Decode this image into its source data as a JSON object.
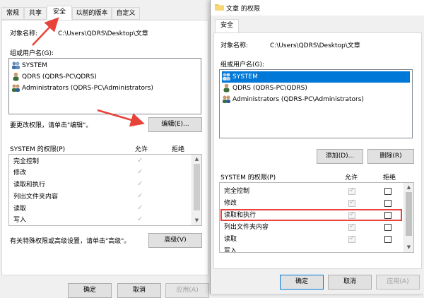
{
  "colors": {
    "accent": "#0078d7",
    "arrow": "#e8433a",
    "highlight": "#e8433a"
  },
  "back": {
    "tabs": [
      "常规",
      "共享",
      "安全",
      "以前的版本",
      "自定义"
    ],
    "object_label": "对象名称:",
    "object_path": "C:\\Users\\QDRS\\Desktop\\文章",
    "group_label": "组或用户名(G):",
    "users": [
      "SYSTEM",
      "QDRS (QDRS-PC\\QDRS)",
      "Administrators (QDRS-PC\\Administrators)"
    ],
    "hint": "要更改权限，请单击\"编辑\"。",
    "edit_button": "编辑(E)...",
    "perm_title": "SYSTEM 的权限(P)",
    "allow_header": "允许",
    "deny_header": "拒绝",
    "perms": [
      "完全控制",
      "修改",
      "读取和执行",
      "列出文件夹内容",
      "读取",
      "写入"
    ],
    "advanced_hint": "有关特殊权限或高级设置，请单击\"高级\"。",
    "advanced_button": "高级(V)",
    "ok": "确定",
    "cancel": "取消",
    "apply": "应用(A)"
  },
  "front": {
    "title": "文章 的权限",
    "tab": "安全",
    "object_label": "对象名称:",
    "object_path": "C:\\Users\\QDRS\\Desktop\\文章",
    "group_label": "组或用户名(G):",
    "users": [
      "SYSTEM",
      "QDRS (QDRS-PC\\QDRS)",
      "Administrators (QDRS-PC\\Administrators)"
    ],
    "selected_user": 0,
    "add_button": "添加(D)...",
    "remove_button": "删除(R)",
    "perm_title": "SYSTEM 的权限(P)",
    "allow_header": "允许",
    "deny_header": "拒绝",
    "perms": [
      "完全控制",
      "修改",
      "读取和执行",
      "列出文件夹内容",
      "读取",
      "写入"
    ],
    "highlighted_perm": 2,
    "ok": "确定",
    "cancel": "取消",
    "apply": "应用(A)"
  }
}
